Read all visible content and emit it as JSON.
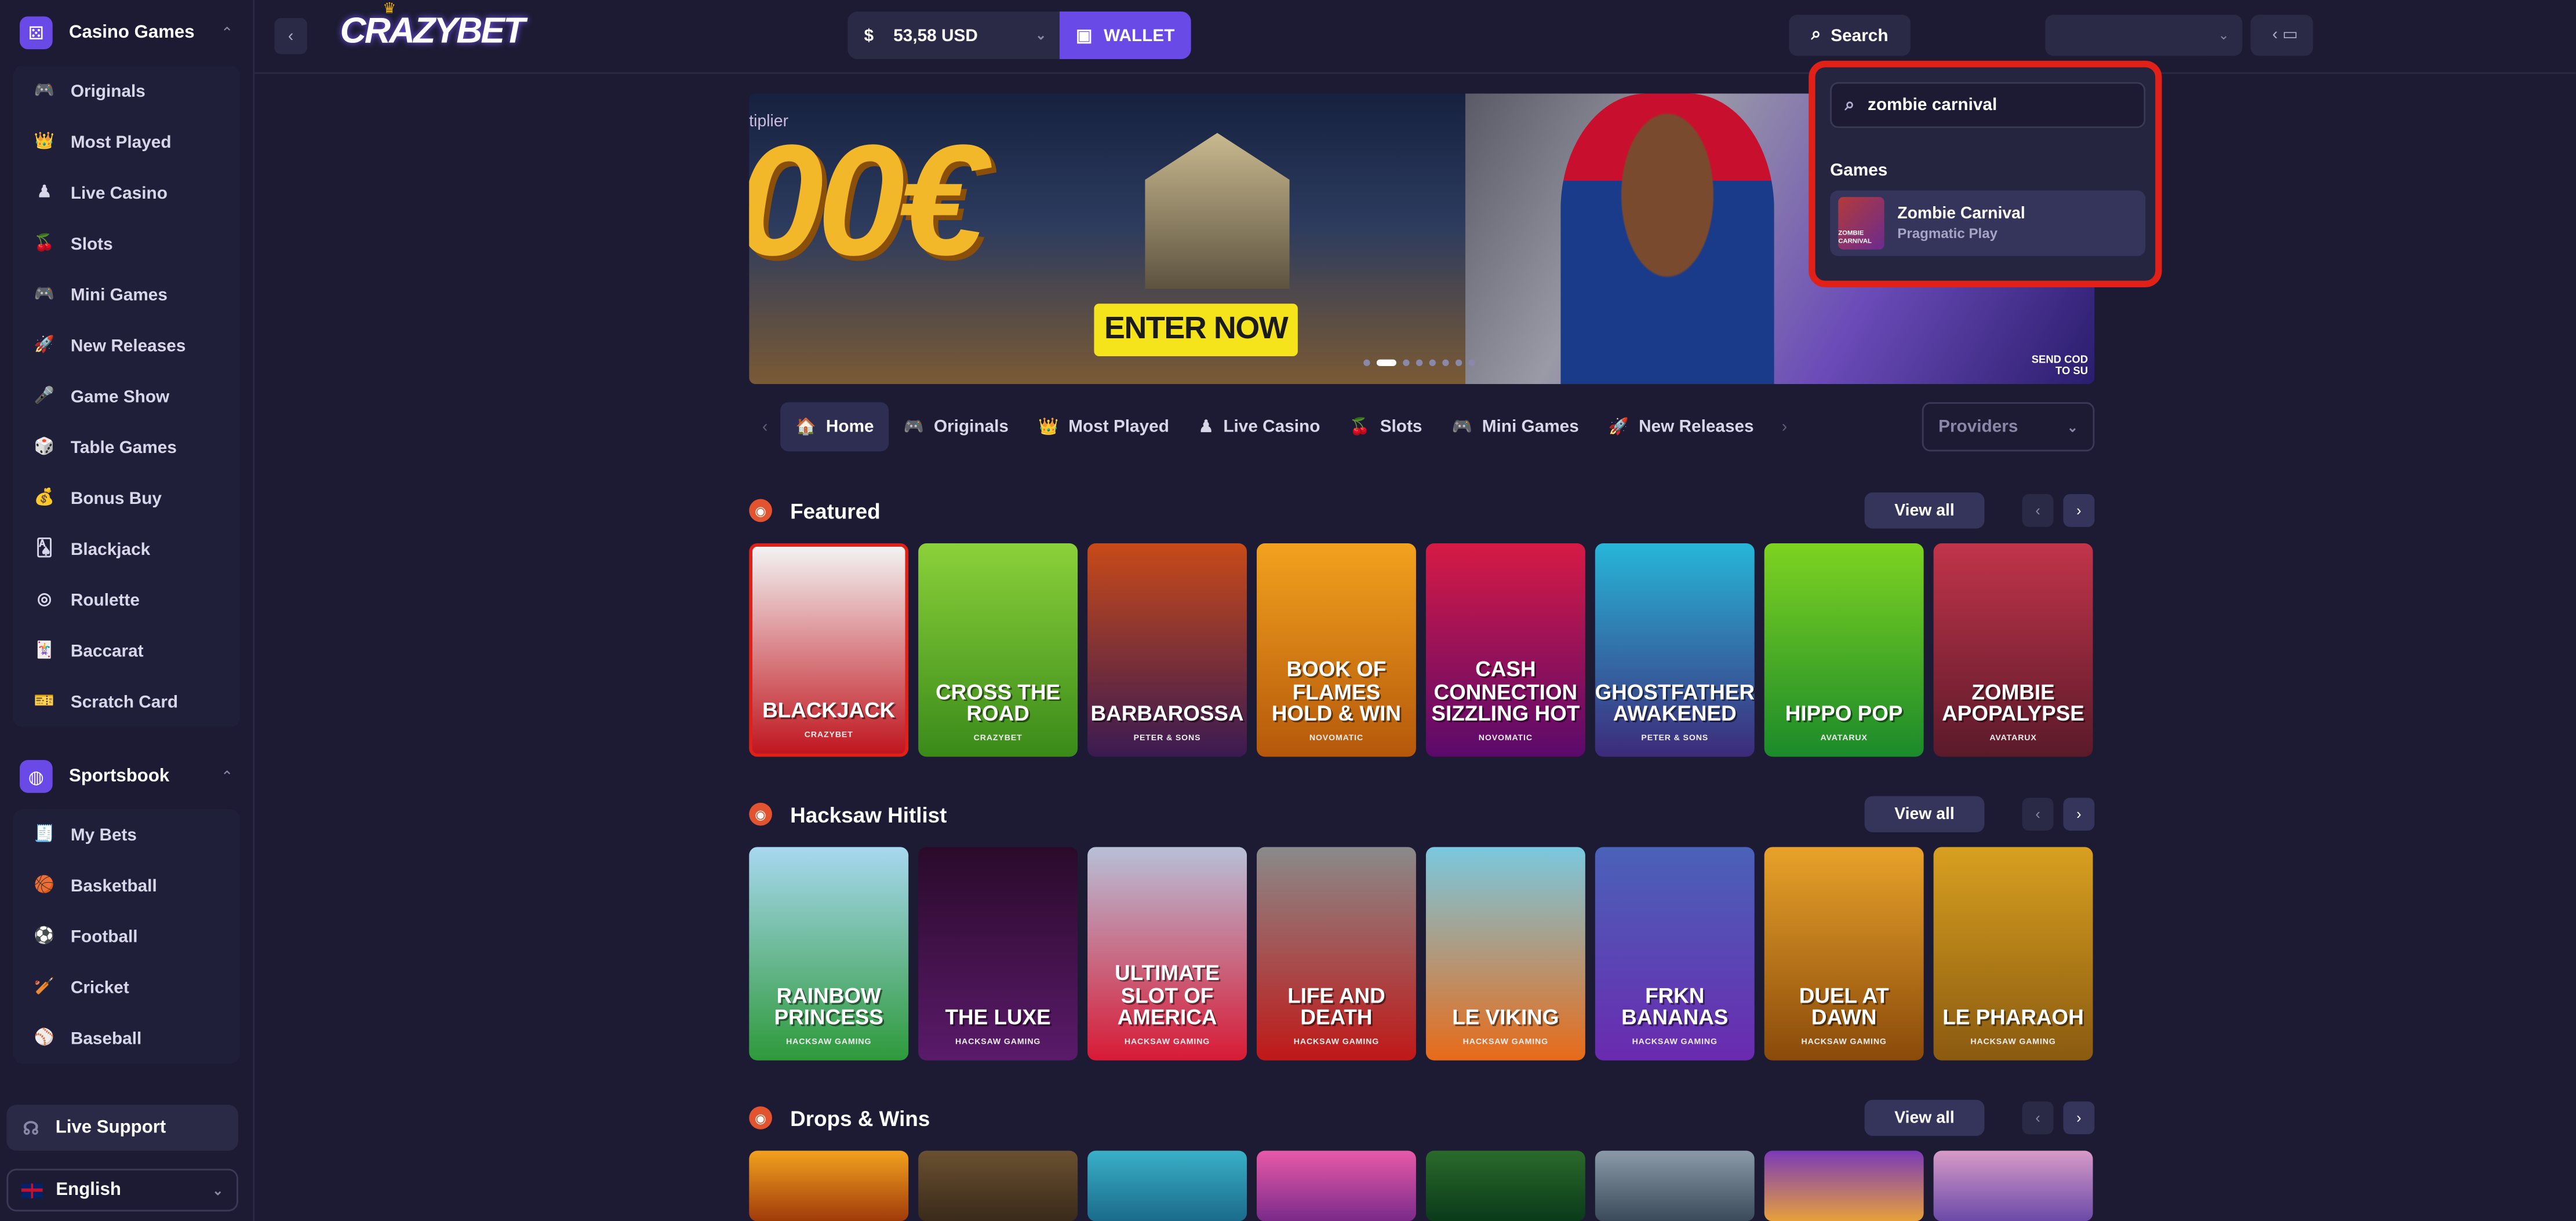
{
  "sidebar": {
    "casino_title": "Casino Games",
    "casino_items": [
      {
        "label": "Originals",
        "icon": "🎮"
      },
      {
        "label": "Most Played",
        "icon": "👑"
      },
      {
        "label": "Live Casino",
        "icon": "♟"
      },
      {
        "label": "Slots",
        "icon": "🍒"
      },
      {
        "label": "Mini Games",
        "icon": "🎮"
      },
      {
        "label": "New Releases",
        "icon": "🚀"
      },
      {
        "label": "Game Show",
        "icon": "🎤"
      },
      {
        "label": "Table Games",
        "icon": "🎲"
      },
      {
        "label": "Bonus Buy",
        "icon": "💰"
      },
      {
        "label": "Blackjack",
        "icon": "🂡"
      },
      {
        "label": "Roulette",
        "icon": "◎"
      },
      {
        "label": "Baccarat",
        "icon": "🃏"
      },
      {
        "label": "Scratch Card",
        "icon": "🎫"
      }
    ],
    "sports_title": "Sportsbook",
    "sports_items": [
      {
        "label": "My Bets",
        "icon": "🧾"
      },
      {
        "label": "Basketball",
        "icon": "🏀"
      },
      {
        "label": "Football",
        "icon": "⚽"
      },
      {
        "label": "Cricket",
        "icon": "🏏"
      },
      {
        "label": "Baseball",
        "icon": "⚾"
      }
    ],
    "support": "Live Support",
    "language": "English"
  },
  "header": {
    "logo": "CRAZYBET",
    "currency_symbol": "$",
    "balance": "53,58 USD",
    "wallet": "WALLET",
    "search": "Search"
  },
  "search_popup": {
    "query": "zombie carnival",
    "section": "Games",
    "result_title": "Zombie Carnival",
    "result_provider": "Pragmatic Play",
    "result_thumb": "ZOMBIE CARNIVAL"
  },
  "banner": {
    "partial_text": "tiplier",
    "amount": "00€",
    "cta": "ENTER NOW",
    "send_code": "SEND COD\nTO SU",
    "slide_count": 8,
    "active_slide": 1
  },
  "tabs": [
    {
      "label": "Home",
      "icon": "🏠"
    },
    {
      "label": "Originals",
      "icon": "🎮"
    },
    {
      "label": "Most Played",
      "icon": "👑"
    },
    {
      "label": "Live Casino",
      "icon": "♟"
    },
    {
      "label": "Slots",
      "icon": "🍒"
    },
    {
      "label": "Mini Games",
      "icon": "🎮"
    },
    {
      "label": "New Releases",
      "icon": "🚀"
    }
  ],
  "providers": "Providers",
  "sections": [
    {
      "title": "Featured",
      "view_all": "View all",
      "games": [
        {
          "title": "BLACKJACK",
          "provider": "CRAZYBET",
          "color1": "#f3f3f3",
          "color2": "#c0161f"
        },
        {
          "title": "CROSS THE ROAD",
          "provider": "CRAZYBET",
          "color1": "#8bd13a",
          "color2": "#3a8a1a"
        },
        {
          "title": "BARBAROSSA",
          "provider": "PETER & SONS",
          "color1": "#c84a18",
          "color2": "#3a1a52"
        },
        {
          "title": "BOOK OF FLAMES HOLD & WIN",
          "provider": "NOVOMATIC",
          "color1": "#f2a21e",
          "color2": "#b5580b"
        },
        {
          "title": "CASH CONNECTION SIZZLING HOT",
          "provider": "NOVOMATIC",
          "color1": "#d61a45",
          "color2": "#5a0a6b"
        },
        {
          "title": "GHOSTFATHER AWAKENED",
          "provider": "PETER & SONS",
          "color1": "#27b6d8",
          "color2": "#3d2a7a"
        },
        {
          "title": "HIPPO POP",
          "provider": "AVATARUX",
          "color1": "#7ed321",
          "color2": "#1b8a2a"
        },
        {
          "title": "ZOMBIE APOPALYPSE",
          "provider": "AVATARUX",
          "color1": "#c2344a",
          "color2": "#5a1a2a"
        }
      ]
    },
    {
      "title": "Hacksaw Hitlist",
      "view_all": "View all",
      "games": [
        {
          "title": "RAINBOW PRINCESS",
          "provider": "HACKSAW GAMING",
          "color1": "#a8d8f0",
          "color2": "#2e9a3a"
        },
        {
          "title": "THE LUXE",
          "provider": "HACKSAW GAMING",
          "color1": "#2a0a2a",
          "color2": "#5a1a6a"
        },
        {
          "title": "ULTIMATE SLOT OF AMERICA",
          "provider": "HACKSAW GAMING",
          "color1": "#b8c0d8",
          "color2": "#d81a35"
        },
        {
          "title": "LIFE AND DEATH",
          "provider": "HACKSAW GAMING",
          "color1": "#8a8a8a",
          "color2": "#c01818"
        },
        {
          "title": "LE VIKING",
          "provider": "HACKSAW GAMING",
          "color1": "#7ac8e0",
          "color2": "#e86a18"
        },
        {
          "title": "FRKN BANANAS",
          "provider": "HACKSAW GAMING",
          "color1": "#4a62b8",
          "color2": "#6a2ab0"
        },
        {
          "title": "DUEL AT DAWN",
          "provider": "HACKSAW GAMING",
          "color1": "#e8a22a",
          "color2": "#8a4a0a"
        },
        {
          "title": "LE PHARAOH",
          "provider": "HACKSAW GAMING",
          "color1": "#d8a020",
          "color2": "#8a5a10"
        }
      ]
    },
    {
      "title": "Drops & Wins",
      "view_all": "View all",
      "games": [
        {
          "title": "",
          "provider": "",
          "color1": "#f2a21e",
          "color2": "#a03a0a"
        },
        {
          "title": "",
          "provider": "",
          "color1": "#6a5030",
          "color2": "#3a2a1a"
        },
        {
          "title": "",
          "provider": "",
          "color1": "#3ab0c8",
          "color2": "#1a6a8a"
        },
        {
          "title": "",
          "provider": "",
          "color1": "#e85aa8",
          "color2": "#7a2a8a"
        },
        {
          "title": "",
          "provider": "",
          "color1": "#2a6a2a",
          "color2": "#0a3a1a"
        },
        {
          "title": "",
          "provider": "",
          "color1": "#8a9aa8",
          "color2": "#3a4a5a"
        },
        {
          "title": "",
          "provider": "",
          "color1": "#7a3ab8",
          "color2": "#e8a03a"
        },
        {
          "title": "",
          "provider": "",
          "color1": "#d89ac8",
          "color2": "#6a4aa8"
        },
        {
          "title": "",
          "provider": "",
          "color1": "#c01838",
          "color2": "#3a0a3a"
        }
      ]
    }
  ]
}
